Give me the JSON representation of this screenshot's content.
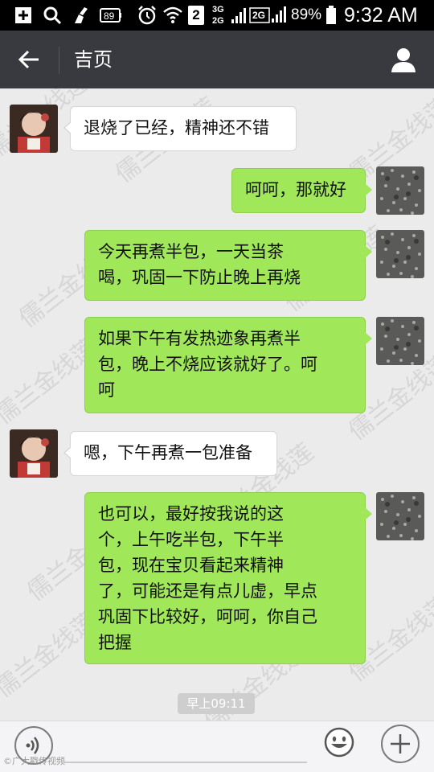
{
  "status_bar": {
    "notification_badge": "89",
    "sim_indicator": "2",
    "network_top": "3G",
    "network_bottom": "2G",
    "network_secondary": "2G",
    "battery_percent": "89%",
    "time": "9:32 AM",
    "icons": [
      "add-notification-icon",
      "search-icon",
      "clean-icon",
      "battery-saver-icon",
      "alarm-icon",
      "wifi-icon",
      "signal-icon",
      "battery-icon"
    ]
  },
  "header": {
    "back_icon": "arrow-left-icon",
    "title": "吉页",
    "profile_icon": "person-icon"
  },
  "messages": [
    {
      "side": "in",
      "text": "退烧了已经，精神还不错"
    },
    {
      "side": "out",
      "text": "呵呵，那就好"
    },
    {
      "side": "out",
      "lines": [
        "今天再煮半包，一天当茶",
        "喝，巩固一下防止晚上再烧"
      ]
    },
    {
      "side": "out",
      "lines": [
        "如果下午有发热迹象再煮半",
        "包，晚上不烧应该就好了。呵",
        "呵"
      ]
    },
    {
      "side": "in",
      "text": "嗯，下午再煮一包准备"
    },
    {
      "side": "out",
      "lines": [
        "也可以，最好按我说的这",
        "个，上午吃半包，下午半",
        "包，现在宝贝看起来精神",
        "了，可能还是有点儿虚，早点",
        "巩固下比较好，呵呵，你自己",
        "把握"
      ]
    }
  ],
  "timestamp": "早上09:11",
  "watermark_text": "儒兰金线莲",
  "input_bar": {
    "voice_icon": "voice-icon",
    "emoji_icon": "smiley-icon",
    "plus_icon": "plus-icon"
  },
  "credit": "©广大戳传视频"
}
